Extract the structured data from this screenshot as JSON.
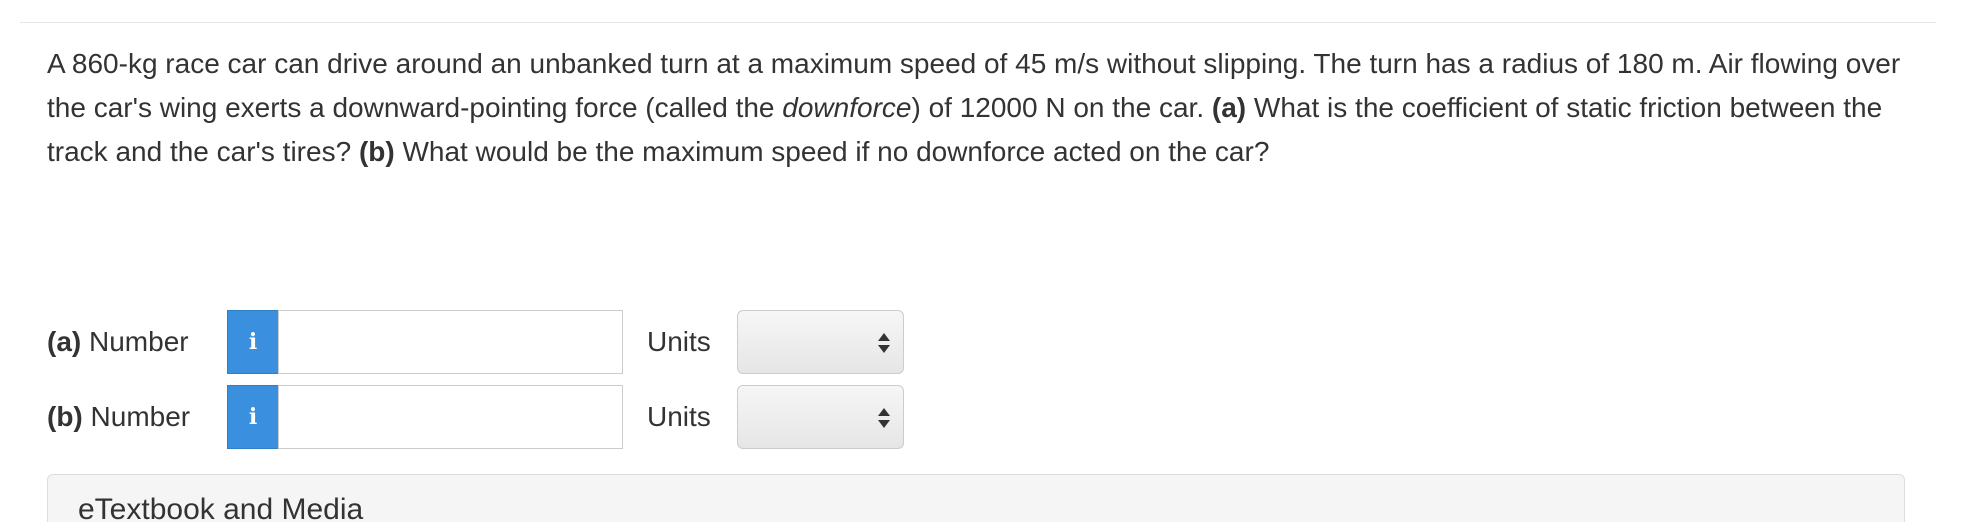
{
  "question": {
    "part1": "A 860-kg race car can drive around an unbanked turn at a maximum speed of 45 m/s without slipping. The turn has a radius of 180 m. Air flowing over the car's wing exerts a downward-pointing force (called the ",
    "emphasis": "downforce",
    "part2": ") of 12000 N on the car. ",
    "a_marker": "(a)",
    "a_text": " What is the coefficient of static friction between the track and the car's tires? ",
    "b_marker": "(b)",
    "b_text": " What would be the maximum speed if no downforce acted on the car?"
  },
  "answers": [
    {
      "marker": "(a)",
      "label": " Number",
      "info_icon": "info-icon",
      "info_glyph": "i",
      "value": "",
      "units_label": "Units",
      "units_value": ""
    },
    {
      "marker": "(b)",
      "label": " Number",
      "info_icon": "info-icon",
      "info_glyph": "i",
      "value": "",
      "units_label": "Units",
      "units_value": ""
    }
  ],
  "media_panel": {
    "title": "eTextbook and Media"
  },
  "colors": {
    "info_button": "#3a8fde",
    "text": "#333333",
    "panel_background": "#f5f5f5"
  }
}
